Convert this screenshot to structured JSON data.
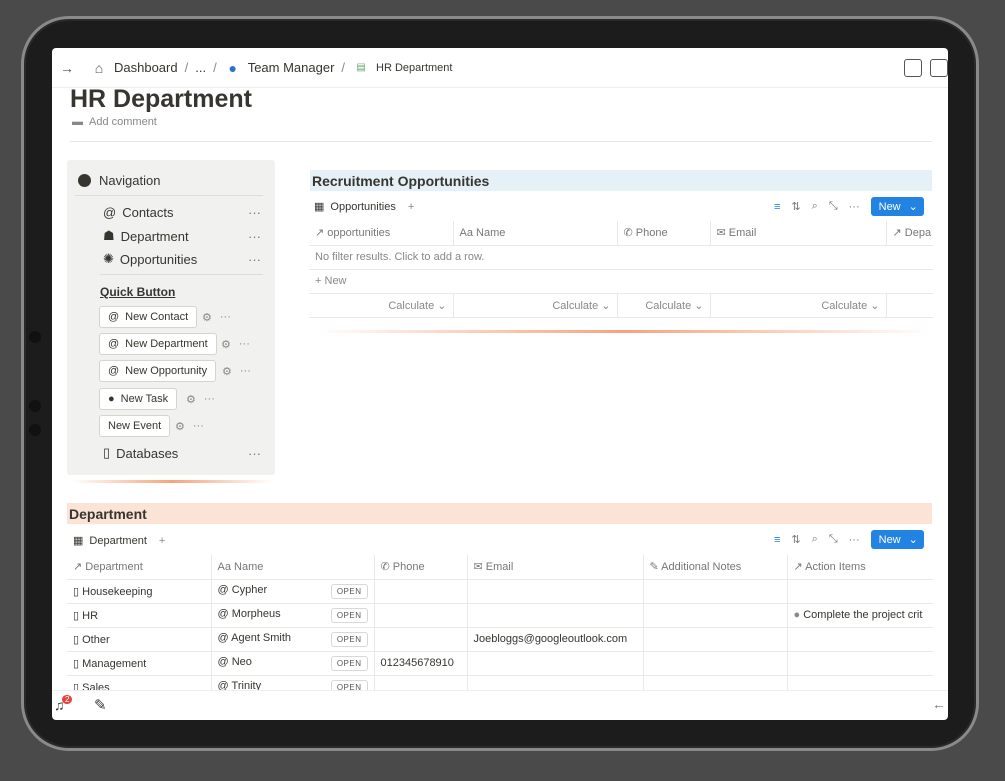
{
  "breadcrumb": {
    "items": [
      "Dashboard",
      "...",
      "Team Manager",
      "HR Department"
    ],
    "separator": "/"
  },
  "page": {
    "title": "HR Department",
    "add_comment": "Add comment"
  },
  "navigation": {
    "title": "Navigation",
    "items": [
      {
        "label": "Contacts",
        "icon": "at-icon"
      },
      {
        "label": "Department",
        "icon": "spy-icon"
      },
      {
        "label": "Opportunities",
        "icon": "sparkle-icon"
      }
    ],
    "quick_button_label": "Quick Button",
    "buttons": [
      "New Contact",
      "New Department",
      "New Opportunity",
      "New Task",
      "New Event"
    ],
    "databases_label": "Databases",
    "more": "···"
  },
  "recruitment": {
    "title": "Recruitment Opportunities",
    "view_label": "Opportunities",
    "new_label": "New",
    "columns": [
      "opportunities",
      "Name",
      "Phone",
      "Email",
      "Depa"
    ],
    "empty_text": "No filter results. Click to add a row.",
    "add_row": "New",
    "calculate": "Calculate"
  },
  "department": {
    "title": "Department",
    "view_label": "Department",
    "new_label": "New",
    "columns": [
      "Department",
      "Name",
      "Phone",
      "Email",
      "Additional Notes",
      "Action Items"
    ],
    "open_label": "OPEN",
    "rows": [
      {
        "department": "Housekeeping",
        "name": "Cypher",
        "phone": "",
        "email": "",
        "notes": "",
        "action": ""
      },
      {
        "department": "HR",
        "name": "Morpheus",
        "phone": "",
        "email": "",
        "notes": "",
        "action": "Complete the project crit"
      },
      {
        "department": "Other",
        "name": "Agent Smith",
        "phone": "",
        "email": "Joebloggs@googleoutlook.com",
        "notes": "",
        "action": ""
      },
      {
        "department": "Management",
        "name": "Neo",
        "phone": "012345678910",
        "email": "",
        "notes": "",
        "action": ""
      },
      {
        "department": "Sales",
        "name": "Trinity",
        "phone": "",
        "email": "",
        "notes": "",
        "action": ""
      }
    ]
  },
  "notifications": {
    "count": "2"
  },
  "colors": {
    "accent": "#2383e2",
    "recruitment_header": "#e6f0f7",
    "department_header": "#fbe4d6"
  }
}
